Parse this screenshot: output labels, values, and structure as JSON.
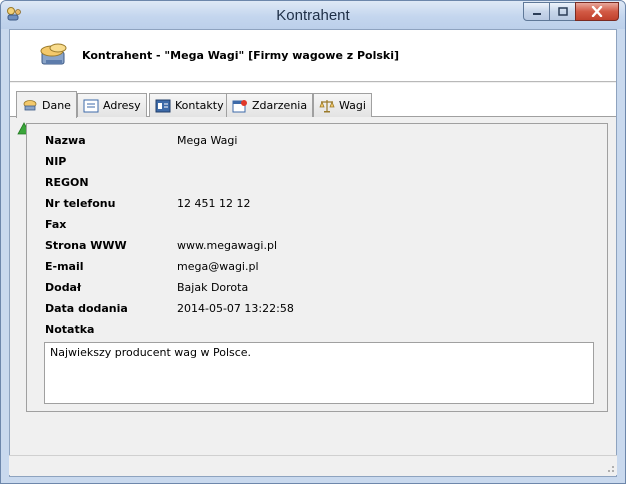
{
  "window": {
    "title": "Kontrahent",
    "minimize_icon": "minimize-icon",
    "maximize_icon": "maximize-icon",
    "close_icon": "close-icon"
  },
  "header": {
    "title": "Kontrahent - \"Mega Wagi\" [Firmy wagowe z Polski]",
    "icon": "contractor-icon"
  },
  "tabs": [
    {
      "label": "Dane",
      "icon": "data-icon",
      "active": true
    },
    {
      "label": "Adresy",
      "icon": "address-icon",
      "active": false
    },
    {
      "label": "Kontakty",
      "icon": "contacts-icon",
      "active": false
    },
    {
      "label": "Zdarzenia",
      "icon": "events-icon",
      "active": false
    },
    {
      "label": "Wagi",
      "icon": "scales-icon",
      "active": false
    }
  ],
  "toolbar": {
    "add_icon": "triangle-up-icon"
  },
  "fields": [
    {
      "label": "Nazwa",
      "value": "Mega Wagi"
    },
    {
      "label": "NIP",
      "value": ""
    },
    {
      "label": "REGON",
      "value": ""
    },
    {
      "label": "Nr telefonu",
      "value": "12 451 12 12"
    },
    {
      "label": "Fax",
      "value": ""
    },
    {
      "label": "Strona WWW",
      "value": "www.megawagi.pl"
    },
    {
      "label": "E-mail",
      "value": "mega@wagi.pl"
    },
    {
      "label": "Dodał",
      "value": "Bajak Dorota"
    },
    {
      "label": "Data dodania",
      "value": "2014-05-07 13:22:58"
    }
  ],
  "note": {
    "label": "Notatka",
    "value": "Najwiekszy producent wag w Polsce."
  },
  "colors": {
    "titlebar": "#c4d6ee",
    "close_button": "#d25a45",
    "panel_bg": "#f0f0f0",
    "add_icon": "#3aa53a"
  }
}
